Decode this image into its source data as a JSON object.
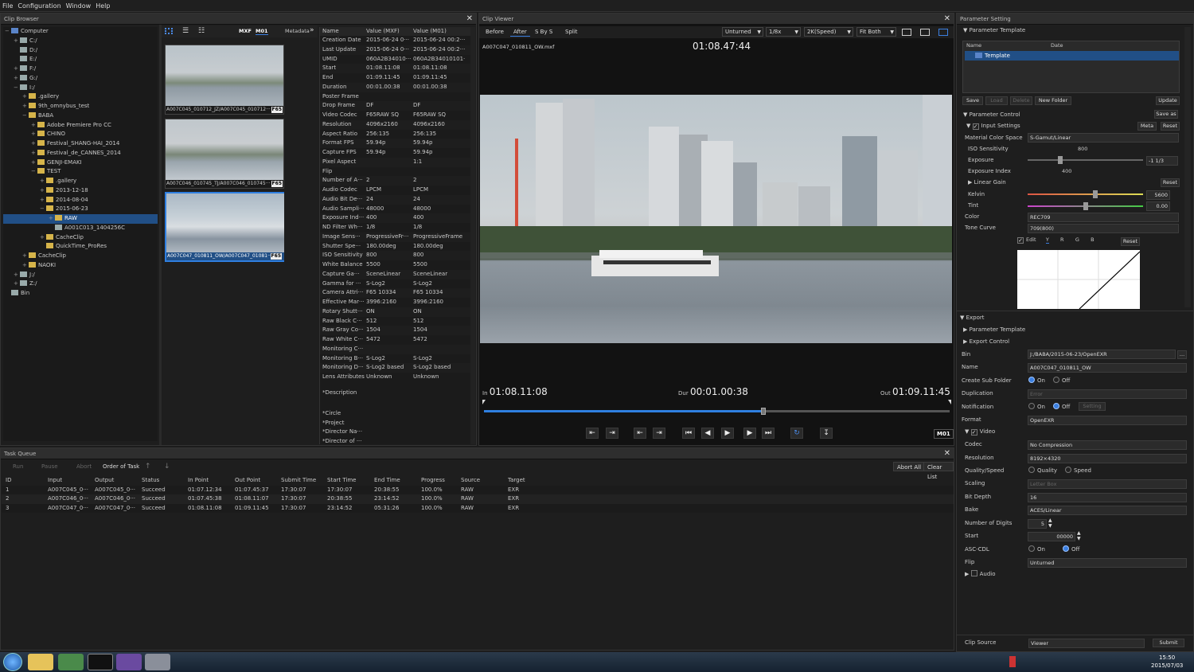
{
  "menu": [
    "File",
    "Configuration",
    "Window",
    "Help"
  ],
  "clip_browser": {
    "title": "Clip Browser",
    "tree": [
      {
        "label": "Computer",
        "indent": 0,
        "exp": "−",
        "icon": "pc"
      },
      {
        "label": "C:/",
        "indent": 1,
        "exp": "+",
        "icon": "drv"
      },
      {
        "label": "D:/",
        "indent": 1,
        "exp": "",
        "icon": "drv"
      },
      {
        "label": "E:/",
        "indent": 1,
        "exp": "",
        "icon": "drv"
      },
      {
        "label": "F:/",
        "indent": 1,
        "exp": "+",
        "icon": "drv"
      },
      {
        "label": "G:/",
        "indent": 1,
        "exp": "+",
        "icon": "drv"
      },
      {
        "label": "I:/",
        "indent": 1,
        "exp": "−",
        "icon": "drv"
      },
      {
        "label": ".gallery",
        "indent": 2,
        "exp": "+",
        "icon": "fold"
      },
      {
        "label": "9th_omnybus_test",
        "indent": 2,
        "exp": "+",
        "icon": "fold"
      },
      {
        "label": "BABA",
        "indent": 2,
        "exp": "−",
        "icon": "fold"
      },
      {
        "label": "Adobe Premiere Pro CC",
        "indent": 3,
        "exp": "+",
        "icon": "fold"
      },
      {
        "label": "CHINO",
        "indent": 3,
        "exp": "+",
        "icon": "fold"
      },
      {
        "label": "Festival_SHANG-HAI_2014",
        "indent": 3,
        "exp": "+",
        "icon": "fold"
      },
      {
        "label": "Festival_de_CANNES_2014",
        "indent": 3,
        "exp": "+",
        "icon": "fold"
      },
      {
        "label": "GENJI-EMAKI",
        "indent": 3,
        "exp": "+",
        "icon": "fold"
      },
      {
        "label": "TEST",
        "indent": 3,
        "exp": "−",
        "icon": "fold"
      },
      {
        "label": ".gallery",
        "indent": 4,
        "exp": "+",
        "icon": "fold"
      },
      {
        "label": "2013-12-18",
        "indent": 4,
        "exp": "+",
        "icon": "fold"
      },
      {
        "label": "2014-08-04",
        "indent": 4,
        "exp": "+",
        "icon": "fold"
      },
      {
        "label": "2015-06-23",
        "indent": 4,
        "exp": "−",
        "icon": "fold"
      },
      {
        "label": "RAW",
        "indent": 5,
        "exp": "+",
        "icon": "fold",
        "selected": true
      },
      {
        "label": "A001C013_1404256C",
        "indent": 5,
        "exp": "",
        "icon": "clip"
      },
      {
        "label": "CacheClip",
        "indent": 4,
        "exp": "+",
        "icon": "fold"
      },
      {
        "label": "QuickTime_ProRes",
        "indent": 4,
        "exp": "",
        "icon": "fold"
      },
      {
        "label": "CacheClip",
        "indent": 2,
        "exp": "+",
        "icon": "fold"
      },
      {
        "label": "NAOKI",
        "indent": 2,
        "exp": "+",
        "icon": "fold"
      },
      {
        "label": "J:/",
        "indent": 1,
        "exp": "+",
        "icon": "drv"
      },
      {
        "label": "Z:/",
        "indent": 1,
        "exp": "+",
        "icon": "drv"
      },
      {
        "label": "Bin",
        "indent": 0,
        "exp": "",
        "icon": "bin"
      }
    ],
    "view_buttons": [
      "MXF",
      "M01"
    ],
    "metadata_label": "Metadata",
    "thumbs": [
      {
        "caption": "A007C045_010712_JZ/A007C045_010712···",
        "badge": "F65"
      },
      {
        "caption": "A007C046_010745_TJ/A007C046_010745···",
        "badge": "F65"
      },
      {
        "caption": "A007C047_010811_OW/A007C047_01081···",
        "badge": "F65"
      }
    ]
  },
  "metadata": {
    "headers": [
      "Name",
      "Value (MXF)",
      "Value (M01)"
    ],
    "rows": [
      [
        "Creation Date",
        "2015-06-24 0···",
        "2015-06-24 00:2···"
      ],
      [
        "Last Update",
        "2015-06-24 0···",
        "2015-06-24 00:2···"
      ],
      [
        "UMID",
        "060A2B34010···",
        "060A2B34010101···"
      ],
      [
        "Start",
        "01:08.11:08",
        "01:08.11:08"
      ],
      [
        "End",
        "01:09.11:45",
        "01:09.11:45"
      ],
      [
        "Duration",
        "00:01.00:38",
        "00:01.00:38"
      ],
      [
        "Poster Frame",
        "",
        ""
      ],
      [
        "Drop Frame",
        "DF",
        "DF"
      ],
      [
        "Video Codec",
        "F65RAW SQ",
        "F65RAW SQ"
      ],
      [
        "Resolution",
        "4096x2160",
        "4096x2160"
      ],
      [
        "Aspect Ratio",
        "256:135",
        "256:135"
      ],
      [
        "Format FPS",
        "59.94p",
        "59.94p"
      ],
      [
        "Capture FPS",
        "59.94p",
        "59.94p"
      ],
      [
        "Pixel Aspect",
        "",
        "1:1"
      ],
      [
        "Flip",
        "",
        ""
      ],
      [
        "Number of A···",
        "2",
        "2"
      ],
      [
        "Audio Codec",
        "LPCM",
        "LPCM"
      ],
      [
        "Audio Bit De···",
        "24",
        "24"
      ],
      [
        "Audio Sampli···",
        "48000",
        "48000"
      ],
      [
        "Exposure Ind···",
        "400",
        "400"
      ],
      [
        "ND Filter Wh···",
        "1/8",
        "1/8"
      ],
      [
        "Image Sens···",
        "ProgressiveFr···",
        "ProgressiveFrame"
      ],
      [
        "Shutter Spe···",
        "180.00deg",
        "180.00deg"
      ],
      [
        "ISO Sensitivity",
        "800",
        "800"
      ],
      [
        "White Balance",
        "5500",
        "5500"
      ],
      [
        "Capture Ga···",
        "SceneLinear",
        "SceneLinear"
      ],
      [
        "Gamma for ···",
        "S-Log2",
        "S-Log2"
      ],
      [
        "Camera Attri···",
        "F65  10334",
        "F65  10334"
      ],
      [
        "Effective Mar···",
        "3996:2160",
        "3996:2160"
      ],
      [
        "Rotary Shutt···",
        "ON",
        "ON"
      ],
      [
        "Raw Black C···",
        "512",
        "512"
      ],
      [
        "Raw Gray Co···",
        "1504",
        "1504"
      ],
      [
        "Raw White C···",
        "5472",
        "5472"
      ],
      [
        "Monitoring C···",
        "",
        ""
      ],
      [
        "Monitoring B···",
        "S-Log2",
        "S-Log2"
      ],
      [
        "Monitoring D···",
        "S-Log2 based",
        "S-Log2 based"
      ],
      [
        "Lens Attributes",
        "Unknown",
        "Unknown"
      ]
    ],
    "extra": [
      "*Description",
      "*Circle",
      "*Project",
      "*Director Na···",
      "*Director of ···"
    ]
  },
  "viewer": {
    "title": "Clip Viewer",
    "modes": [
      "Before",
      "After",
      "S By S",
      "Split"
    ],
    "dropdowns": [
      "Unturned",
      "1/8x",
      "2K(Speed)",
      "Fit Both"
    ],
    "filename": "A007C047_010811_OW.mxf",
    "timecode": "01:08.47:44",
    "in_label": "In",
    "in_tc": "01:08.11:08",
    "dur_label": "Dur",
    "dur_tc": "00:01.00:38",
    "out_label": "Out",
    "out_tc": "01:09.11:45",
    "progress": 0.6,
    "format_badge": "M01"
  },
  "task_queue": {
    "title": "Task Queue",
    "buttons": [
      "Run",
      "Pause",
      "Abort",
      "Order of Task"
    ],
    "right_buttons": [
      "Abort All",
      "Clear List"
    ],
    "headers": [
      "ID",
      "Input",
      "Output",
      "Status",
      "In Point",
      "Out Point",
      "Submit Time",
      "Start Time",
      "End Time",
      "Progress",
      "Source",
      "Target"
    ],
    "rows": [
      [
        "1",
        "A007C045_0···",
        "A007C045_0···",
        "Succeed",
        "01:07.12:34",
        "01:07.45:37",
        "17:30:07",
        "17:30:07",
        "20:38:55",
        "100.0%",
        "RAW",
        "EXR"
      ],
      [
        "2",
        "A007C046_0···",
        "A007C046_0···",
        "Succeed",
        "01:07.45:38",
        "01:08.11:07",
        "17:30:07",
        "20:38:55",
        "23:14:52",
        "100.0%",
        "RAW",
        "EXR"
      ],
      [
        "3",
        "A007C047_0···",
        "A007C047_0···",
        "Succeed",
        "01:08.11:08",
        "01:09.11:45",
        "17:30:07",
        "23:14:52",
        "05:31:26",
        "100.0%",
        "RAW",
        "EXR"
      ]
    ]
  },
  "params": {
    "title": "Parameter Setting",
    "template_label": "Parameter Template",
    "col_name": "Name",
    "col_date": "Date",
    "template_item": "Template",
    "tpl_buttons": [
      "Save",
      "Load",
      "Delete",
      "New Folder",
      "Update"
    ],
    "control_label": "Parameter Control",
    "save_as": "Save as",
    "input_settings": "Input Settings",
    "meta_btn": "Meta",
    "reset": "Reset",
    "material_color_space_label": "Material Color Space",
    "material_color_space": "S-Gamut/Linear",
    "iso_label": "ISO Sensitivity",
    "iso": "800",
    "exposure_label": "Exposure",
    "exposure": "-1 1/3",
    "exposure_index_label": "Exposure Index",
    "exposure_index": "400",
    "linear_gain": "Linear Gain",
    "kelvin_label": "Kelvin",
    "kelvin": "5600",
    "tint_label": "Tint",
    "tint": "0.00",
    "color_label": "Color",
    "color": "REC709",
    "tone_label": "Tone Curve",
    "tone": "709(800)",
    "curve_tabs": [
      "Edit",
      "Y",
      "R",
      "G",
      "B"
    ],
    "export_label": "Export",
    "export_template": "Parameter Template",
    "export_control": "Export Control",
    "bin_label": "Bin",
    "bin": "J:/BABA/2015-06-23/OpenEXR",
    "name_label": "Name",
    "name": "A007C047_010811_OW",
    "subfolder_label": "Create Sub Folder",
    "on": "On",
    "off": "Off",
    "dup_label": "Duplication",
    "dup": "Error",
    "notif_label": "Notification",
    "setting": "Setting",
    "format_label": "Format",
    "format": "OpenEXR",
    "video_label": "Video",
    "codec_label": "Codec",
    "codec": "No Compression",
    "res_label": "Resolution",
    "res": "8192×4320",
    "qs_label": "Quality/Speed",
    "quality": "Quality",
    "speed": "Speed",
    "scaling_label": "Scaling",
    "scaling": "Letter Box",
    "bitdepth_label": "Bit Depth",
    "bitdepth": "16",
    "bake_label": "Bake",
    "bake": "ACES/Linear",
    "digits_label": "Number of Digits",
    "digits": "5",
    "start_label": "Start",
    "start": "00000",
    "asc_label": "ASC-CDL",
    "flip_label": "Flip",
    "flip": "Unturned",
    "audio_label": "Audio",
    "clip_source_label": "Clip Source",
    "clip_source": "Viewer",
    "submit": "Submit"
  },
  "taskbar": {
    "time": "15:50",
    "date": "2015/07/03"
  }
}
